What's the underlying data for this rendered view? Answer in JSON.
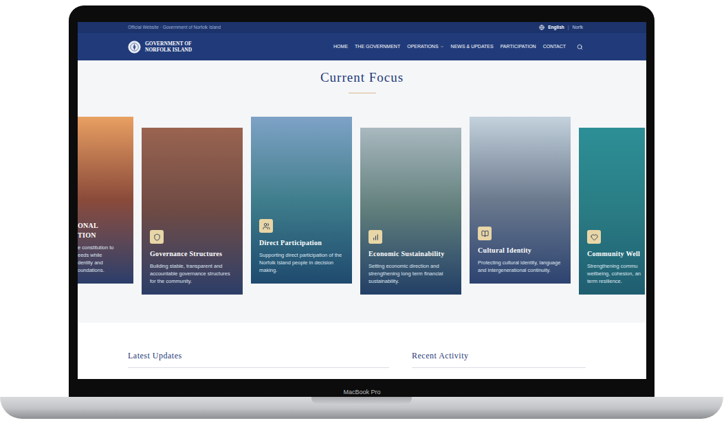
{
  "device_label": "MacBook Pro",
  "top_bar": {
    "label": "Official Website · Government of Norfolk Island",
    "separator": "|",
    "languages": [
      {
        "label": "English",
        "selected": true
      },
      {
        "label": "Norfk",
        "selected": false
      }
    ]
  },
  "nav": {
    "logo_lines": [
      "GOVERNMENT OF",
      "NORFOLK ISLAND"
    ],
    "items": [
      {
        "label": "HOME",
        "dropdown": false
      },
      {
        "label": "THE GOVERNMENT",
        "dropdown": false
      },
      {
        "label": "OPERATIONS",
        "dropdown": true
      },
      {
        "label": "NEWS & UPDATES",
        "dropdown": false
      },
      {
        "label": "PARTICIPATION",
        "dropdown": false
      },
      {
        "label": "CONTACT",
        "dropdown": false
      }
    ]
  },
  "focus": {
    "title": "Current Focus",
    "cards": [
      {
        "kind": "clipped-left",
        "title_lines": [
          "ONAL",
          "TION"
        ],
        "description_lines": [
          "e constitution to",
          "eeds while",
          "dentity and",
          "oundations."
        ]
      },
      {
        "kind": "full",
        "title_lines": [
          "Governance Structures"
        ],
        "description_lines": [
          "Building stable, transparent and accountable governance structures for the community."
        ]
      },
      {
        "kind": "full",
        "title_lines": [
          "Direct Participation"
        ],
        "description_lines": [
          "Supporting direct participation of the Norfolk Island people in decision making."
        ]
      },
      {
        "kind": "full",
        "title_lines": [
          "Economic Sustainability"
        ],
        "description_lines": [
          "Setting economic direction and strengthening long term financial sustainability."
        ]
      },
      {
        "kind": "full",
        "title_lines": [
          "Cultural Identity"
        ],
        "description_lines": [
          "Protecting cultural identity, language and intergenerational continuity."
        ]
      },
      {
        "kind": "clipped-right",
        "title_lines": [
          "Community Well"
        ],
        "description_lines": [
          "Strengthening commu",
          "wellbeing, cohesion, an",
          "term resilience."
        ]
      }
    ]
  },
  "sections": [
    {
      "title": "Latest Updates"
    },
    {
      "title": "Recent Activity"
    }
  ]
}
